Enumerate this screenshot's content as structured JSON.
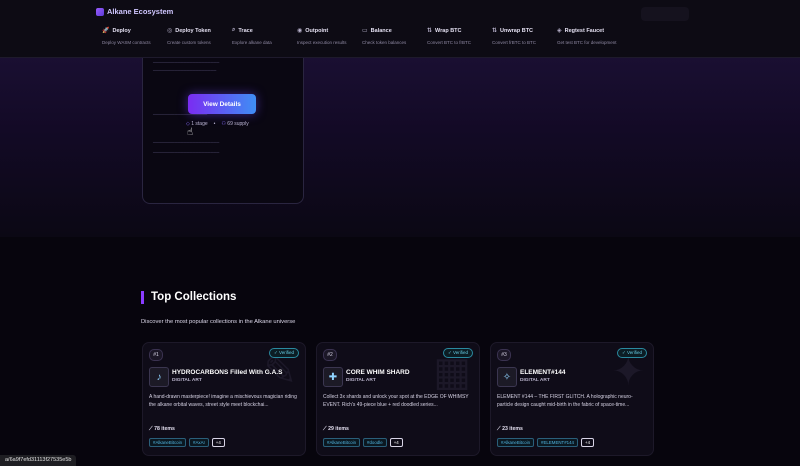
{
  "brand": "Alkane Ecosystem",
  "nav": [
    {
      "icon": "rocket-icon",
      "glyph": "🚀",
      "label": "Deploy",
      "desc": "Deploy WASM contracts"
    },
    {
      "icon": "coins-icon",
      "glyph": "◎",
      "label": "Deploy Token",
      "desc": "Create custom tokens"
    },
    {
      "icon": "search-icon",
      "glyph": "⌕",
      "label": "Trace",
      "desc": "Explore alkane data"
    },
    {
      "icon": "outpoint-icon",
      "glyph": "◉",
      "label": "Outpoint",
      "desc": "Inspect execution results"
    },
    {
      "icon": "wallet-icon",
      "glyph": "▭",
      "label": "Balance",
      "desc": "Check token balances"
    },
    {
      "icon": "swap-icon",
      "glyph": "⇅",
      "label": "Wrap BTC",
      "desc": "Convert BTC to frBTC"
    },
    {
      "icon": "swap-icon",
      "glyph": "⇅",
      "label": "Unwrap BTC",
      "desc": "Convert frBTC to BTC"
    },
    {
      "icon": "faucet-icon",
      "glyph": "◈",
      "label": "Regtest Faucet",
      "desc": "Get test BTC for development"
    }
  ],
  "hero": {
    "button": "View Details",
    "stage": "1 stage",
    "supply": "69 supply"
  },
  "section": {
    "title": "Top Collections",
    "subtitle": "Discover the most popular collections in the Alkane universe"
  },
  "cards": [
    {
      "rank": "#1",
      "verified": "Verified",
      "name": "HYDROCARBONS Filled With G.A.S",
      "category": "DIGITAL ART",
      "description": "A hand-drawn masterpiece! imagine a mischievous magician riding the alkane orbital waves, street style meet blockchai...",
      "items": "78 items",
      "tags": [
        "#AlkaneBitcoin",
        "#AxAI"
      ],
      "more": "+4"
    },
    {
      "rank": "#2",
      "verified": "Verified",
      "name": "CORE WHIM SHARD",
      "category": "DIGITAL ART",
      "description": "Collect 3x shards and unlock your spot at the EDGE OF WHIMSY EVENT. Rich's 49-piece blue + red doodled series...",
      "items": "29 items",
      "tags": [
        "#AlkaneBitcoin",
        "#doodle"
      ],
      "more": "+4"
    },
    {
      "rank": "#3",
      "verified": "Verified",
      "name": "ELEMENT#144",
      "category": "DIGITAL ART",
      "description": "ELEMENT #144 – THE FIRST GLITCH. A holographic neuro-particle design caught mid-birth in the fabric of space-time...",
      "items": "23 items",
      "tags": [
        "#AlkaneBitcoin",
        "#ELEMENT#144"
      ],
      "more": "+4"
    }
  ],
  "status_url": "a/6a9f7efd31113f27535e5b"
}
